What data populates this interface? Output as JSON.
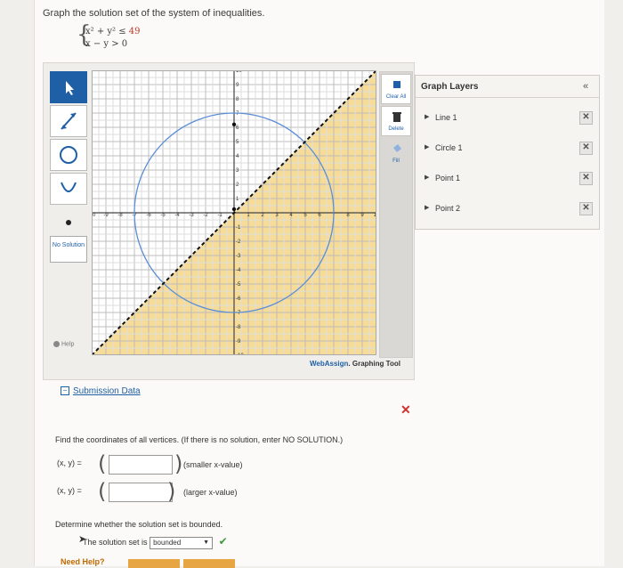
{
  "prompt": "Graph the solution set of the system of inequalities.",
  "system": {
    "ineq1_left": "x² + y² ≤ ",
    "ineq1_right": "49",
    "ineq2": "x −  y > 0"
  },
  "graph": {
    "x_ticks": [
      "-10",
      "-9",
      "-8",
      "-7",
      "-6",
      "-5",
      "-4",
      "-3",
      "-2",
      "-1",
      "1",
      "2",
      "3",
      "4",
      "5",
      "6",
      "7",
      "8",
      "9",
      "10"
    ],
    "y_ticks": [
      "10",
      "9",
      "8",
      "7",
      "6",
      "5",
      "4",
      "3",
      "2",
      "1",
      "-1",
      "-2",
      "-3",
      "-4",
      "-5",
      "-6",
      "-7",
      "-8",
      "-9",
      "-10"
    ],
    "x_range": [
      -10,
      10
    ],
    "y_range": [
      -10,
      10
    ],
    "circle_radius": 7,
    "line": "y = x (dashed)",
    "shading_color": "#f6dc97",
    "circle_color": "#5b8ed6"
  },
  "toolbar": {
    "tools": [
      "pointer-icon",
      "line-icon",
      "circle-icon",
      "parabola-icon",
      "point-icon"
    ],
    "no_solution": "No Solution",
    "help": "Help"
  },
  "side": {
    "clear_all": "Clear All",
    "delete": "Delete",
    "fill": "Fill"
  },
  "brand": {
    "web": "Web",
    "assign": "Assign",
    "rest": ". Graphing Tool"
  },
  "layers": {
    "title": "Graph Layers",
    "collapse": "«",
    "items": [
      "Line 1",
      "Circle 1",
      "Point 1",
      "Point 2"
    ]
  },
  "submission": "Submission Data",
  "question1": "Find the coordinates of all vertices. (If there is no solution, enter NO SOLUTION.)",
  "answers": [
    {
      "label": "(x, y) =",
      "value": "",
      "note": "(smaller x-value)"
    },
    {
      "label": "(x, y) =",
      "value": "",
      "note": "(larger x-value)"
    }
  ],
  "question2": "Determine whether the solution set is bounded.",
  "bounded_prefix": "The solution set is",
  "bounded_value": "bounded",
  "need_help": "Need Help?"
}
